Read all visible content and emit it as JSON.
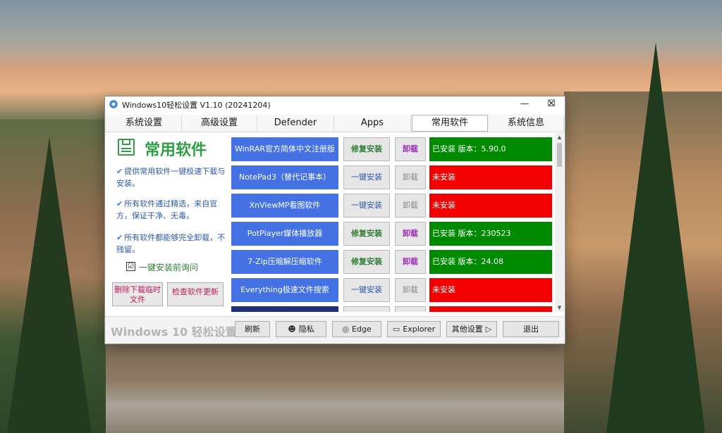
{
  "window": {
    "title": "Windows10轻松设置 V1.10  (20241204)",
    "controls": {
      "minimize": "—",
      "maximize": "☐",
      "close": "✕"
    }
  },
  "tabs": [
    {
      "label": "系统设置"
    },
    {
      "label": "高级设置"
    },
    {
      "label": "Defender"
    },
    {
      "label": "Apps"
    },
    {
      "label": "常用软件",
      "active": true
    },
    {
      "label": "系统信息"
    }
  ],
  "sidebar": {
    "icon": "save-icon",
    "title": "常用软件",
    "notes": [
      "提供常用软件一键极速下载与安装。",
      "所有软件通过精选，来自官方，保证干净、无毒。",
      "所有软件都能够完全卸载，不残留。"
    ],
    "checkbox": {
      "label": "一键安装前询问",
      "checked": true,
      "mark": "☑"
    },
    "buttons": {
      "delete_temp": "删除下载临时文件",
      "check_update": "检查软件更新"
    }
  },
  "software": [
    {
      "name": "WinRAR官方简体中文注册版",
      "action": "修复安装",
      "uninstall": "卸载",
      "status": "已安装 版本：5.90.0",
      "installed": true
    },
    {
      "name": "NotePad3（替代记事本）",
      "action": "一键安装",
      "uninstall": "卸载",
      "status": "未安装",
      "installed": false
    },
    {
      "name": "XnViewMP看图软件",
      "action": "一键安装",
      "uninstall": "卸载",
      "status": "未安装",
      "installed": false
    },
    {
      "name": "PotPlayer媒体播放器",
      "action": "修复安装",
      "uninstall": "卸载",
      "status": "已安装 版本：230523",
      "installed": true
    },
    {
      "name": "7-Zip压缩解压缩软件",
      "action": "修复安装",
      "uninstall": "卸载",
      "status": "已安装 版本：24.08",
      "installed": true
    },
    {
      "name": "Everything极速文件搜索",
      "action": "一键安装",
      "uninstall": "卸载",
      "status": "未安装",
      "installed": false
    }
  ],
  "colors": {
    "installed": "#008a00",
    "not_installed": "#f20000",
    "name_button": "#4472e4",
    "name_button_partial": "#1f2f7a"
  },
  "footer": {
    "brand": "Windows 10 轻松设置",
    "refresh": "刷新",
    "privacy": "隐私",
    "edge": "Edge",
    "explorer": "Explorer",
    "other": "其他设置",
    "exit": "退出"
  }
}
